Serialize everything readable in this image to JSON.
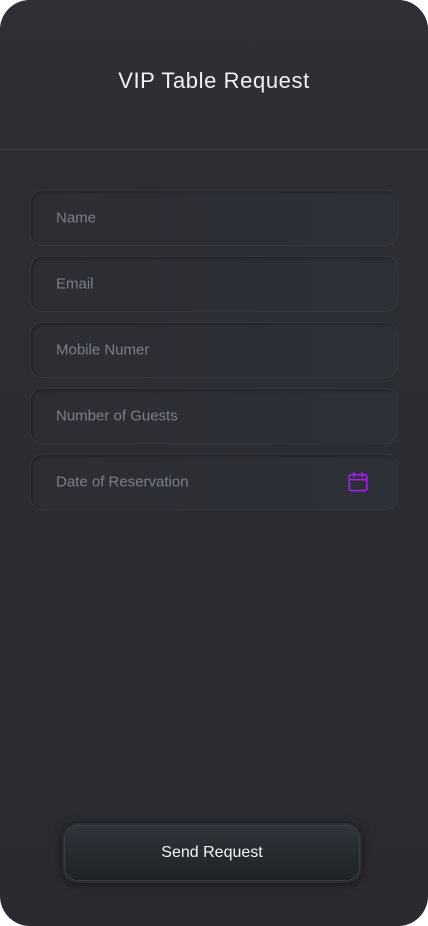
{
  "header": {
    "title": "VIP Table Request"
  },
  "form": {
    "name_placeholder": "Name",
    "email_placeholder": "Email",
    "mobile_placeholder": "Mobile Numer",
    "guests_placeholder": "Number of Guests",
    "date_placeholder": "Date of Reservation",
    "date_icon": "calendar-icon"
  },
  "actions": {
    "send_label": "Send Request"
  },
  "colors": {
    "accent": "#a020f0",
    "background": "#2b2d32",
    "placeholder_text": "#7c7f88"
  }
}
